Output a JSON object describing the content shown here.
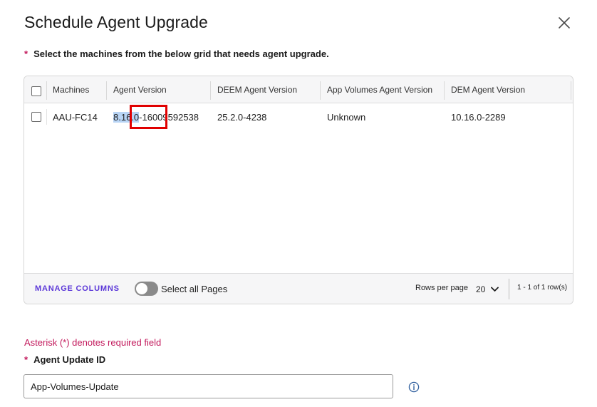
{
  "dialog": {
    "title": "Schedule Agent Upgrade"
  },
  "instruction": {
    "required_marker": "*",
    "text": "Select the machines from the below grid that needs agent upgrade."
  },
  "grid": {
    "columns": [
      "Machines",
      "Agent Version",
      "DEEM Agent Version",
      "App Volumes Agent Version",
      "DEM Agent Version"
    ],
    "rows": [
      {
        "machine": "AAU-FC14",
        "agent_version_selected": "8.16.0",
        "agent_version_rest": "-16009592538",
        "deem_agent_version": "25.2.0-4238",
        "app_volumes_agent_version": "Unknown",
        "dem_agent_version": "10.16.0-2289"
      }
    ],
    "footer": {
      "manage_columns": "MANAGE COLUMNS",
      "select_all_pages": "Select all Pages",
      "rows_per_page_label": "Rows per page",
      "rows_per_page_value": "20",
      "range": "1 - 1 of 1 row(s)"
    }
  },
  "form": {
    "asterisk_note": "Asterisk (*) denotes required field",
    "agent_update_id_label": "Agent Update ID",
    "required_marker": "*",
    "agent_update_id_value": "App-Volumes-Update"
  },
  "colors": {
    "accent": "#5b37d8",
    "required": "#c2185b",
    "highlight_box": "#e00000",
    "text_selection": "#b8d4f5"
  },
  "icons": {
    "close": "close-icon",
    "info": "info-icon",
    "dropdown": "chevron-down-icon"
  }
}
